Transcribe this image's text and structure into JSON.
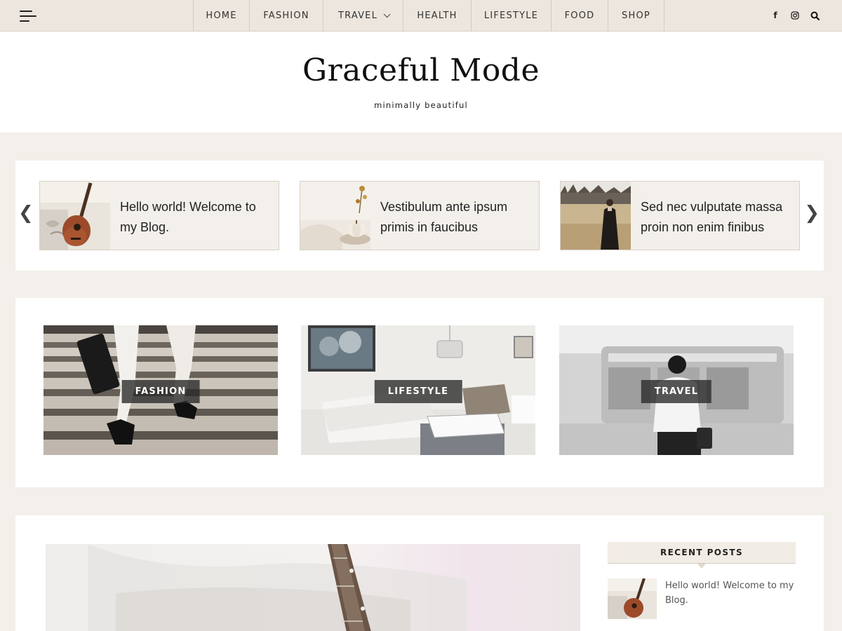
{
  "nav": {
    "menu": [
      {
        "label": "HOME",
        "has_dropdown": false
      },
      {
        "label": "FASHION",
        "has_dropdown": false
      },
      {
        "label": "TRAVEL",
        "has_dropdown": true
      },
      {
        "label": "HEALTH",
        "has_dropdown": false
      },
      {
        "label": "LIFESTYLE",
        "has_dropdown": false
      },
      {
        "label": "FOOD",
        "has_dropdown": false
      },
      {
        "label": "SHOP",
        "has_dropdown": false
      }
    ],
    "icons": [
      "menu-icon",
      "facebook-icon",
      "instagram-icon",
      "search-icon"
    ]
  },
  "header": {
    "title": "Graceful Mode",
    "tagline": "minimally beautiful"
  },
  "carousel": {
    "slides": [
      {
        "title": "Hello world! Welcome to my Blog.",
        "image": "guitar"
      },
      {
        "title": "Vestibulum ante ipsum primis in faucibus",
        "image": "pumpkin"
      },
      {
        "title": "Sed nec vulputate massa proin non enim finibus",
        "image": "woman-field"
      }
    ]
  },
  "categories": [
    {
      "label": "FASHION",
      "image": "stairs-heels"
    },
    {
      "label": "LIFESTYLE",
      "image": "living-room"
    },
    {
      "label": "TRAVEL",
      "image": "train-woman"
    }
  ],
  "sidebar": {
    "recent_posts_title": "RECENT POSTS",
    "recent_posts": [
      {
        "title": "Hello world! Welcome to my Blog.",
        "image": "guitar"
      }
    ]
  },
  "colors": {
    "page_bg": "#f3efea",
    "nav_bg": "#ece6de",
    "card_bg": "#ffffff",
    "label_bg": "#3a3a3a"
  }
}
